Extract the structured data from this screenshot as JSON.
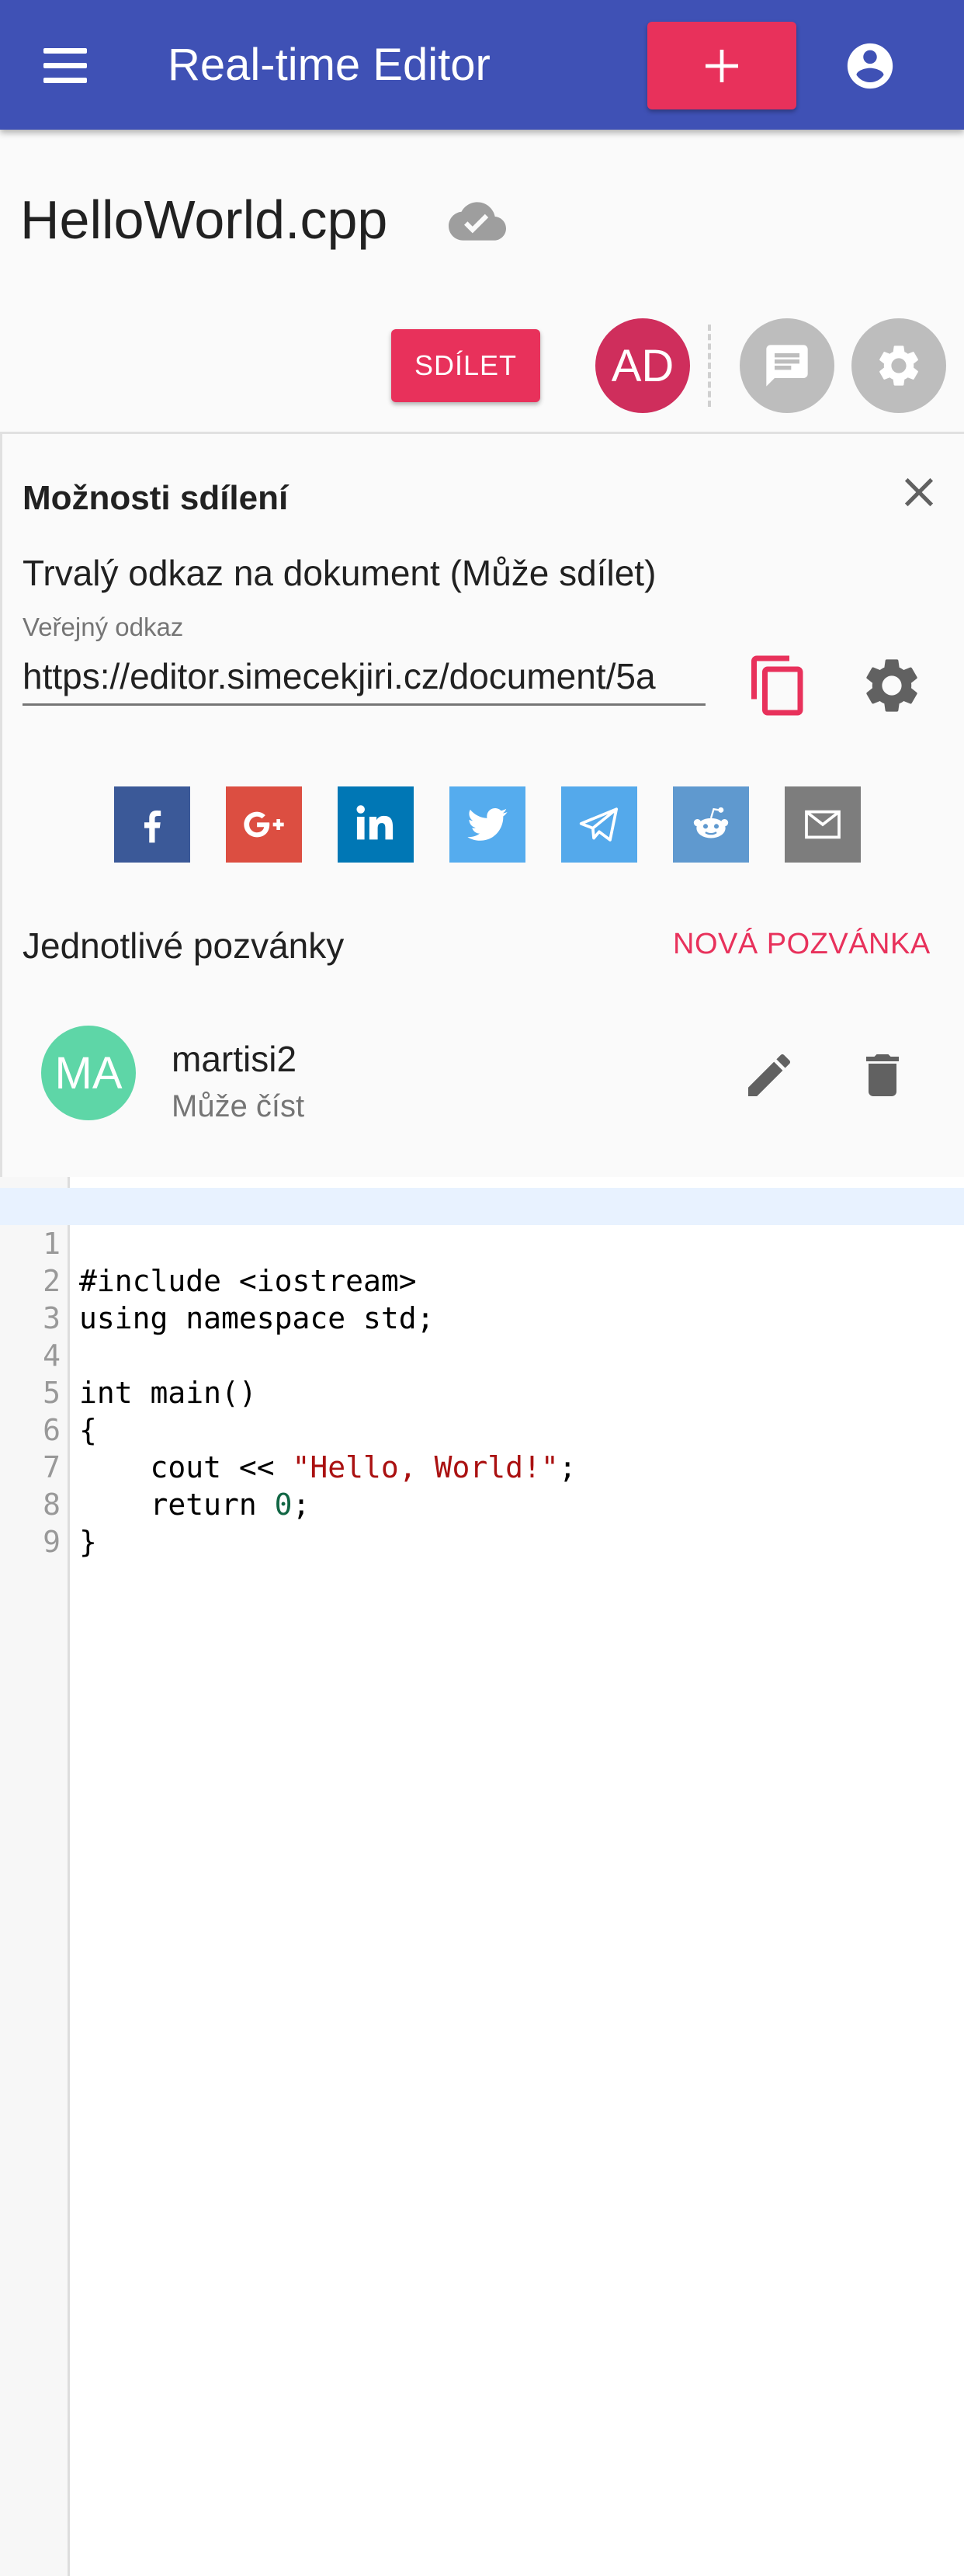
{
  "appbar": {
    "title": "Real-time Editor",
    "menu_icon": "hamburger-menu-icon",
    "add_icon": "plus-icon",
    "account_icon": "account-circle-icon",
    "color": "#3f51b5",
    "accent": "#e8315b"
  },
  "document": {
    "title": "HelloWorld.cpp",
    "sync_icon": "cloud-done-icon"
  },
  "toolbar": {
    "share_label": "SDÍLET",
    "user_initials": "AD",
    "chat_icon": "chat-icon",
    "settings_icon": "gear-icon"
  },
  "share_panel": {
    "title": "Možnosti sdílení",
    "permanent_link_label": "Trvalý odkaz na dokument (Může sdílet)",
    "public_link_label": "Veřejný odkaz",
    "public_link_value": "https://editor.simecekjiri.cz/document/5a",
    "social": [
      {
        "name": "facebook",
        "color": "#3b5998"
      },
      {
        "name": "google-plus",
        "color": "#dc4e41"
      },
      {
        "name": "linkedin",
        "color": "#0077b5"
      },
      {
        "name": "twitter",
        "color": "#55acee"
      },
      {
        "name": "telegram",
        "color": "#54a9eb"
      },
      {
        "name": "reddit",
        "color": "#5f99cf"
      },
      {
        "name": "email",
        "color": "#7d7d7d"
      }
    ],
    "invites_label": "Jednotlivé pozvánky",
    "new_invite_label": "NOVÁ POZVÁNKA",
    "invites": [
      {
        "initials": "MA",
        "name": "martisi2",
        "role": "Může číst",
        "avatar_color": "#5ed6a7"
      }
    ]
  },
  "editor": {
    "lines": [
      {
        "n": "1",
        "text": "#include <iostream>"
      },
      {
        "n": "2",
        "text": "using namespace std;"
      },
      {
        "n": "3",
        "text": ""
      },
      {
        "n": "4",
        "text": "int main()"
      },
      {
        "n": "5",
        "text": "{"
      },
      {
        "n": "6",
        "pre": "    cout << ",
        "str": "\"Hello, World!\"",
        "post": ";"
      },
      {
        "n": "7",
        "pre": "    return ",
        "num": "0",
        "post": ";"
      },
      {
        "n": "8",
        "text": "}"
      },
      {
        "n": "9",
        "text": ""
      }
    ]
  }
}
